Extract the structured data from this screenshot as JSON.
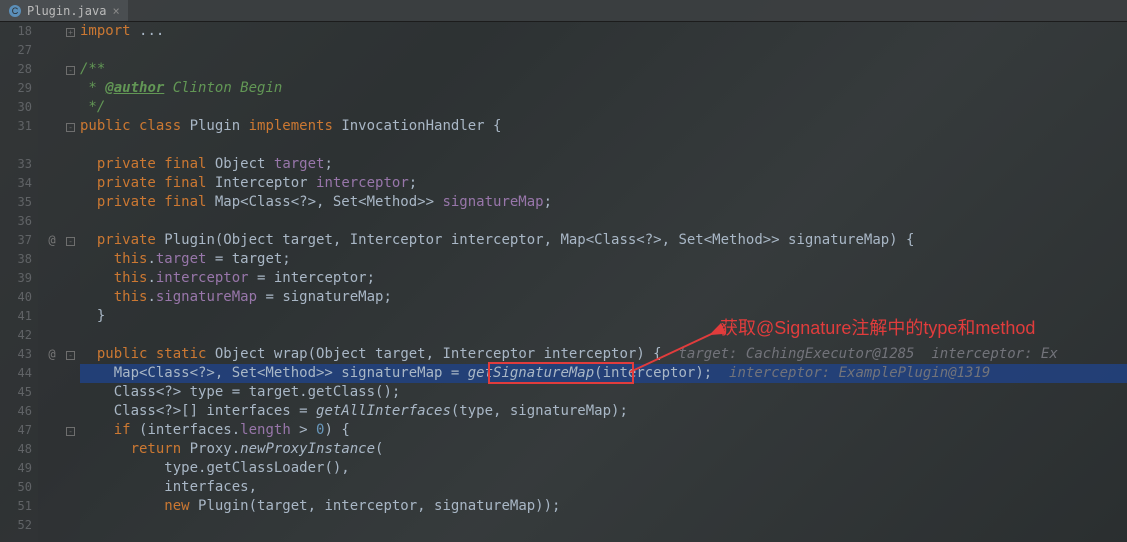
{
  "tab": {
    "name": "Plugin.java"
  },
  "gutter": {
    "numbers": [
      "18",
      "27",
      "28",
      "29",
      "30",
      "31",
      "",
      "33",
      "34",
      "35",
      "36",
      "37",
      "38",
      "39",
      "40",
      "41",
      "42",
      "43",
      "44",
      "45",
      "46",
      "47",
      "48",
      "49",
      "50",
      "51",
      "52"
    ],
    "ann": [
      "",
      "",
      "",
      "",
      "",
      "",
      "",
      "",
      "",
      "",
      "",
      "@",
      "",
      "",
      "",
      "",
      "",
      "@",
      "",
      "",
      "",
      "",
      "",
      "",
      "",
      "",
      ""
    ],
    "fold": [
      "+",
      "",
      "-",
      "",
      "",
      "-",
      "",
      "",
      "",
      "",
      "",
      "-",
      "",
      "",
      "",
      "",
      "",
      "-",
      "",
      "",
      "",
      "-",
      "",
      "",
      "",
      "",
      ""
    ]
  },
  "annotation": {
    "text": "获取@Signature注解中的type和method"
  },
  "code": {
    "l18": {
      "kw": "import ",
      "rest": "..."
    },
    "l28": {
      "doc": "/**"
    },
    "l29": {
      "doc_pre": " * ",
      "tag": "@author",
      "author": " Clinton Begin"
    },
    "l30": {
      "doc": " */"
    },
    "l31": {
      "kw1": "public class ",
      "name": "Plugin ",
      "kw2": "implements ",
      "iface": "InvocationHandler {"
    },
    "l33": {
      "kw": "private final ",
      "type": "Object ",
      "field": "target",
      "end": ";"
    },
    "l34": {
      "kw": "private final ",
      "type": "Interceptor ",
      "field": "interceptor",
      "end": ";"
    },
    "l35": {
      "kw": "private final ",
      "type": "Map<Class<?>, Set<Method>> ",
      "field": "signatureMap",
      "end": ";"
    },
    "l37": {
      "kw": "private ",
      "ctor": "Plugin",
      "params": "(Object target, Interceptor interceptor, Map<Class<?>, Set<Method>> signatureMap) {"
    },
    "l38": {
      "kw": "this",
      "dot": ".",
      "field": "target",
      "rest": " = target;"
    },
    "l39": {
      "kw": "this",
      "dot": ".",
      "field": "interceptor",
      "rest": " = interceptor;"
    },
    "l40": {
      "kw": "this",
      "dot": ".",
      "field": "signatureMap",
      "rest": " = signatureMap;"
    },
    "l41": {
      "close": "}"
    },
    "l43": {
      "kw": "public static ",
      "ret": "Object ",
      "name": "wrap",
      "params": "(Object target, Interceptor interceptor) {",
      "hint1": "  target: CachingExecutor@1285",
      "hint2": "  interceptor: Ex"
    },
    "l44": {
      "type": "Map<Class<?>, Set<Method>> signatureMap = ",
      "call": "getSignatureMap",
      "args": "(interceptor);",
      "hint": "  interceptor: ExamplePlugin@1319"
    },
    "l45": {
      "text": "Class<?> type = target.getClass();"
    },
    "l46": {
      "pre": "Class<?>[] interfaces = ",
      "call": "getAllInterfaces",
      "args": "(type, signatureMap);"
    },
    "l47": {
      "kw": "if ",
      "pre": "(interfaces.",
      "field": "length",
      "mid": " > ",
      "num": "0",
      "end": ") {"
    },
    "l48": {
      "kw": "return ",
      "pre": "Proxy.",
      "call": "newProxyInstance",
      "end": "("
    },
    "l49": {
      "text": "type.getClassLoader(),"
    },
    "l50": {
      "text": "interfaces,"
    },
    "l51": {
      "kw": "new ",
      "ctor": "Plugin",
      "args": "(target, interceptor, signatureMap));"
    }
  }
}
